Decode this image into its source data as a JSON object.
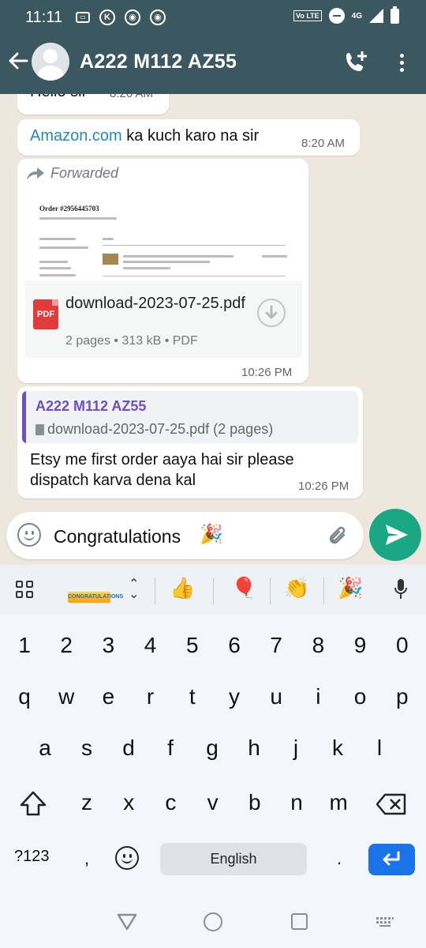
{
  "status_bar": {
    "time": "11:11",
    "network": "4G",
    "volte": "Vo LTE"
  },
  "header": {
    "contact_name": "A222 M112 AZ55"
  },
  "messages": [
    {
      "text": "Hello sir",
      "time": "8:20 AM"
    },
    {
      "link": "Amazon.com",
      "text": " ka kuch karo na sir",
      "time": "8:20 AM"
    },
    {
      "forwarded_label": "Forwarded",
      "preview_order": "Order #2956445703",
      "file_name": "download-2023-07-25.pdf",
      "file_meta": "2 pages • 313 kB • PDF",
      "file_icon_label": "PDF",
      "time": "10:26 PM"
    },
    {
      "quote_name": "A222 M112 AZ55",
      "quote_file": "download-2023-07-25.pdf (2 pages)",
      "text": "Etsy me first order aaya hai sir please dispatch karva dena kal",
      "time": "10:26 PM"
    }
  ],
  "input": {
    "value": "Congratulations",
    "emoji": "🎉"
  },
  "keyboard": {
    "sticker_text": "CONGRATULATIONS",
    "suggestions": [
      "👍",
      "🎈",
      "👏",
      "🎉"
    ],
    "row_numbers": [
      "1",
      "2",
      "3",
      "4",
      "5",
      "6",
      "7",
      "8",
      "9",
      "0"
    ],
    "row1": [
      "q",
      "w",
      "e",
      "r",
      "t",
      "y",
      "u",
      "i",
      "o",
      "p"
    ],
    "row2": [
      "a",
      "s",
      "d",
      "f",
      "g",
      "h",
      "j",
      "k",
      "l"
    ],
    "row3": [
      "z",
      "x",
      "c",
      "v",
      "b",
      "n",
      "m"
    ],
    "symbols_label": "?123",
    "comma": ",",
    "period": ".",
    "space_label": "English"
  },
  "colors": {
    "header": "#3b575f",
    "accent": "#1aa884",
    "link": "#1d8cb8",
    "quote_bar": "#6b4fc6",
    "enter_key": "#1a73e8"
  }
}
